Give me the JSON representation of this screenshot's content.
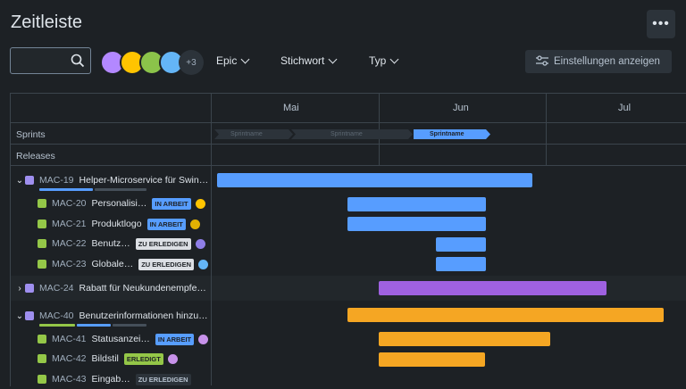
{
  "page": {
    "title": "Zeitleiste",
    "more_label": "•••"
  },
  "search": {
    "value": "",
    "placeholder": ""
  },
  "avatars": {
    "more_count": "+3"
  },
  "filters": [
    {
      "label": "Epic"
    },
    {
      "label": "Stichwort"
    },
    {
      "label": "Typ"
    }
  ],
  "settings": {
    "label": "Einstellungen anzeigen"
  },
  "timeline": {
    "months": [
      "Mai",
      "Jun",
      "Jul"
    ],
    "sprints_label": "Sprints",
    "releases_label": "Releases",
    "sprints": [
      {
        "label": "Sprintname",
        "state": "done"
      },
      {
        "label": "Sprintname",
        "state": "done"
      },
      {
        "label": "Sprintname",
        "state": "active"
      }
    ]
  },
  "colors": {
    "epic_icon": "#9f8fef",
    "story_icon": "#94c748",
    "bar_blue": "#579dff",
    "bar_purple": "#9f61e0",
    "bar_orange": "#f5a623",
    "in_progress": "#579dff",
    "todo": "#dcdfe4",
    "done": "#94c748"
  },
  "rows": [
    {
      "key": "MAC-19",
      "summary": "Helper-Microservice für Swin…",
      "level": "epic",
      "expanded": true
    },
    {
      "key": "MAC-20",
      "summary": "Personalisi…",
      "level": "child",
      "status": "IN ARBEIT"
    },
    {
      "key": "MAC-21",
      "summary": "Produktlogo",
      "level": "child",
      "status": "IN ARBEIT"
    },
    {
      "key": "MAC-22",
      "summary": "Benutz…",
      "level": "child",
      "status": "ZU ERLEDIGEN"
    },
    {
      "key": "MAC-23",
      "summary": "Globale…",
      "level": "child",
      "status": "ZU ERLEDIGEN"
    },
    {
      "key": "MAC-24",
      "summary": "Rabatt für Neukundenempfe…",
      "level": "epic",
      "expanded": false
    },
    {
      "key": "MAC-40",
      "summary": "Benutzerinformationen hinzu…",
      "level": "epic",
      "expanded": true
    },
    {
      "key": "MAC-41",
      "summary": "Statusanzei…",
      "level": "child",
      "status": "IN ARBEIT"
    },
    {
      "key": "MAC-42",
      "summary": "Bildstil",
      "level": "child",
      "status": "ERLEDIGT"
    },
    {
      "key": "MAC-43",
      "summary": "Eingab…",
      "level": "child",
      "status": "ZU ERLEDIGEN"
    }
  ]
}
